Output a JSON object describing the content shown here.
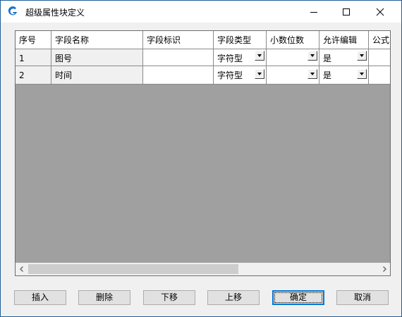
{
  "window": {
    "title": "超级属性块定义"
  },
  "grid": {
    "columns": [
      "序号",
      "字段名称",
      "字段标识",
      "字段类型",
      "小数位数",
      "允许编辑",
      "公式"
    ],
    "rows": [
      {
        "index": "1",
        "name": "图号",
        "id": "",
        "type": "字符型",
        "decimals": "",
        "editable": "是",
        "formula": ""
      },
      {
        "index": "2",
        "name": "时间",
        "id": "",
        "type": "字符型",
        "decimals": "",
        "editable": "是",
        "formula": ""
      }
    ]
  },
  "buttons": {
    "insert": "插入",
    "delete": "删除",
    "move_down": "下移",
    "move_up": "上移",
    "ok": "确定",
    "cancel": "取消"
  },
  "colors": {
    "accent": "#0078d7",
    "grid_background": "#a0a0a0"
  },
  "icons": [
    "app-logo-icon",
    "minimize-icon",
    "maximize-icon",
    "close-icon",
    "dropdown-arrow-icon",
    "scroll-left-arrow-icon",
    "scroll-right-arrow-icon"
  ]
}
